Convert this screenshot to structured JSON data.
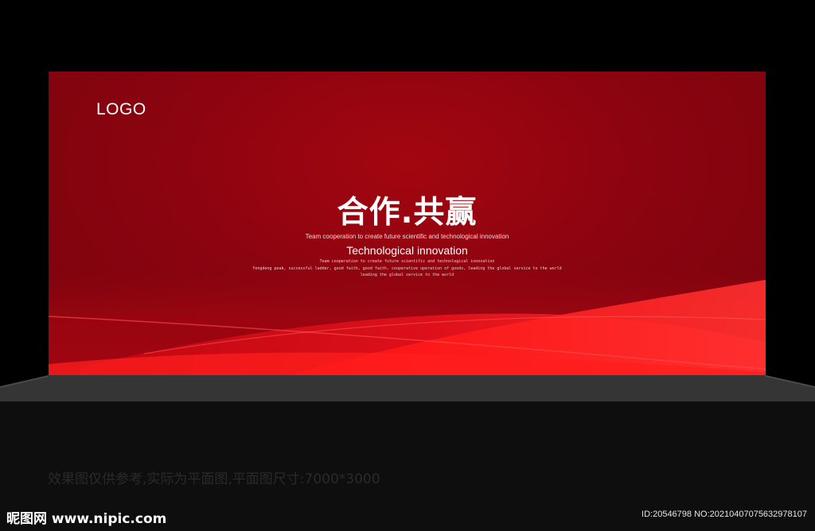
{
  "board": {
    "logo": "LOGO",
    "headline": "合作.共赢",
    "subtitle_small": "Team cooperation to create future scientific and technological innovation",
    "subtitle": "Technological innovation",
    "tiny_lines": [
      "Team cooperation to create future scientific and technological innovation",
      "Yongdeng peak, successful ladder, good faith, good faith, cooperative operation of goods, leading the global service to the world",
      "leading the global service to the world"
    ]
  },
  "footer": {
    "note": "效果图仅供参考,实际为平面图,平面图尺寸:7000*3000",
    "site": "昵图网 www.nipic.com",
    "image_id": "ID:20546798 NO:20210407075632978107"
  },
  "colors": {
    "board_red": "#8c0410",
    "wave_red": "#ff1a1a",
    "floor_gray": "#3a3a3a"
  }
}
